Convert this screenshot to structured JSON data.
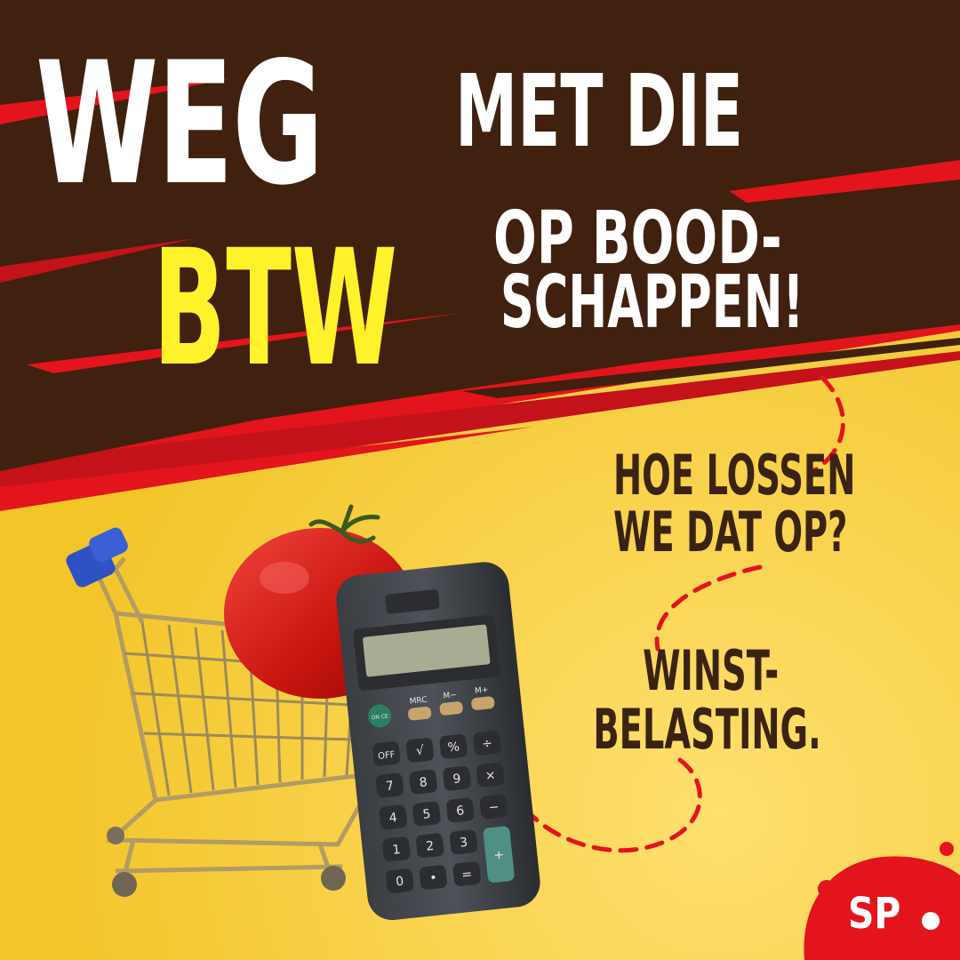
{
  "headline": {
    "weg": "WEG",
    "met_die": "MET DIE",
    "btw": "BTW",
    "op_bood": "OP BOOD-",
    "schappen": "SCHAPPEN!"
  },
  "question": {
    "line1": "HOE LOSSEN",
    "line2": "WE DAT OP?"
  },
  "answer": {
    "line1": "WINST-",
    "line2": "BELASTING."
  },
  "calculator_keys": {
    "on_ce": "ON CE",
    "mrc": "MRC",
    "m_minus": "M−",
    "m_plus": "M+",
    "off": "OFF",
    "sqrt": "√",
    "percent": "%",
    "divide": "÷",
    "k7": "7",
    "k8": "8",
    "k9": "9",
    "times": "×",
    "k4": "4",
    "k5": "5",
    "k6": "6",
    "minus": "−",
    "k1": "1",
    "k2": "2",
    "k3": "3",
    "plus": "+",
    "k0": "0",
    "dot": "•",
    "equals": "="
  },
  "logo": {
    "text": "SP"
  },
  "colors": {
    "background_yellow": "#f6cf3c",
    "band_brown": "#40210f",
    "accent_red": "#e3141c",
    "headline_yellow": "#fff22a",
    "text_brown": "#3a2312"
  }
}
